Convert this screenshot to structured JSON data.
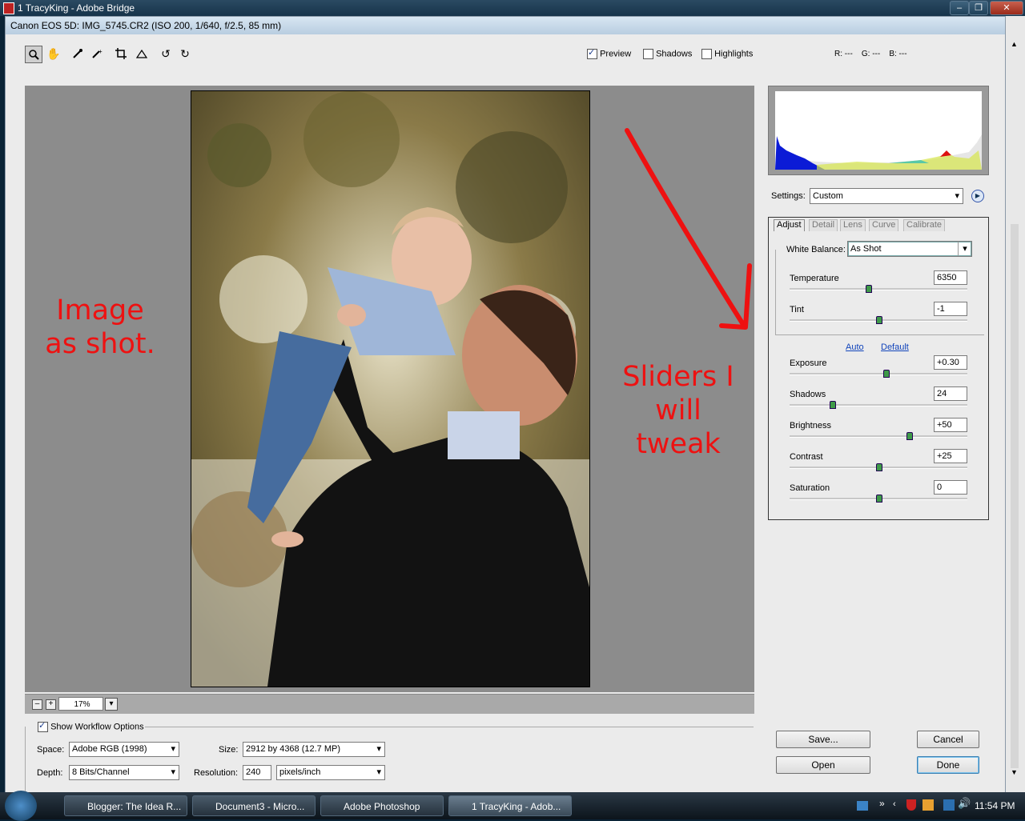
{
  "bridge": {
    "title": "1 TracyKing - Adobe Bridge"
  },
  "dialog": {
    "title": "Canon EOS 5D:  IMG_5745.CR2  (ISO 200, 1/640, f/2.5, 85 mm)"
  },
  "toolbar": {
    "tools": [
      "zoom-tool-icon",
      "hand-tool-icon",
      "white-balance-tool-icon",
      "color-sampler-tool-icon",
      "crop-tool-icon",
      "straighten-tool-icon",
      "rotate-left-icon",
      "rotate-right-icon"
    ],
    "preview_label": "Preview",
    "shadows_label": "Shadows",
    "highlights_label": "Highlights",
    "preview_checked": true,
    "shadows_checked": false,
    "highlights_checked": false
  },
  "rgb_readout": "R: ---    G: ---    B: ---",
  "annotations": {
    "left_line1": "Image",
    "left_line2": "as shot.",
    "right_line1": "Sliders I will",
    "right_line2": "tweak",
    "color": "#e11111"
  },
  "zoom": {
    "value": "17%"
  },
  "workflow": {
    "show_label": "Show Workflow Options",
    "show_checked": true,
    "space_label": "Space:",
    "space_value": "Adobe RGB (1998)",
    "size_label": "Size:",
    "size_value": "2912 by 4368  (12.7 MP)",
    "depth_label": "Depth:",
    "depth_value": "8 Bits/Channel",
    "resolution_label": "Resolution:",
    "resolution_value": "240",
    "resolution_unit": "pixels/inch"
  },
  "settings": {
    "label": "Settings:",
    "value": "Custom"
  },
  "tabs": [
    "Adjust",
    "Detail",
    "Lens",
    "Curve",
    "Calibrate"
  ],
  "adjust": {
    "wb_label": "White Balance:",
    "wb_value": "As Shot",
    "auto_label": "Auto",
    "default_label": "Default",
    "sliders": [
      {
        "label": "Temperature",
        "value": "6350",
        "position": 0.44
      },
      {
        "label": "Tint",
        "value": "-1",
        "position": 0.5
      },
      {
        "label": "Exposure",
        "value": "+0.30",
        "position": 0.54
      },
      {
        "label": "Shadows",
        "value": "24",
        "position": 0.24
      },
      {
        "label": "Brightness",
        "value": "+50",
        "position": 0.67
      },
      {
        "label": "Contrast",
        "value": "+25",
        "position": 0.5
      },
      {
        "label": "Saturation",
        "value": "0",
        "position": 0.5
      }
    ]
  },
  "buttons": {
    "save": "Save...",
    "cancel": "Cancel",
    "open": "Open",
    "done": "Done"
  },
  "taskbar": {
    "items": [
      "Blogger: The Idea R...",
      "Document3 - Micro...",
      "Adobe Photoshop",
      "1 TracyKing - Adob..."
    ],
    "clock": "11:54 PM"
  }
}
